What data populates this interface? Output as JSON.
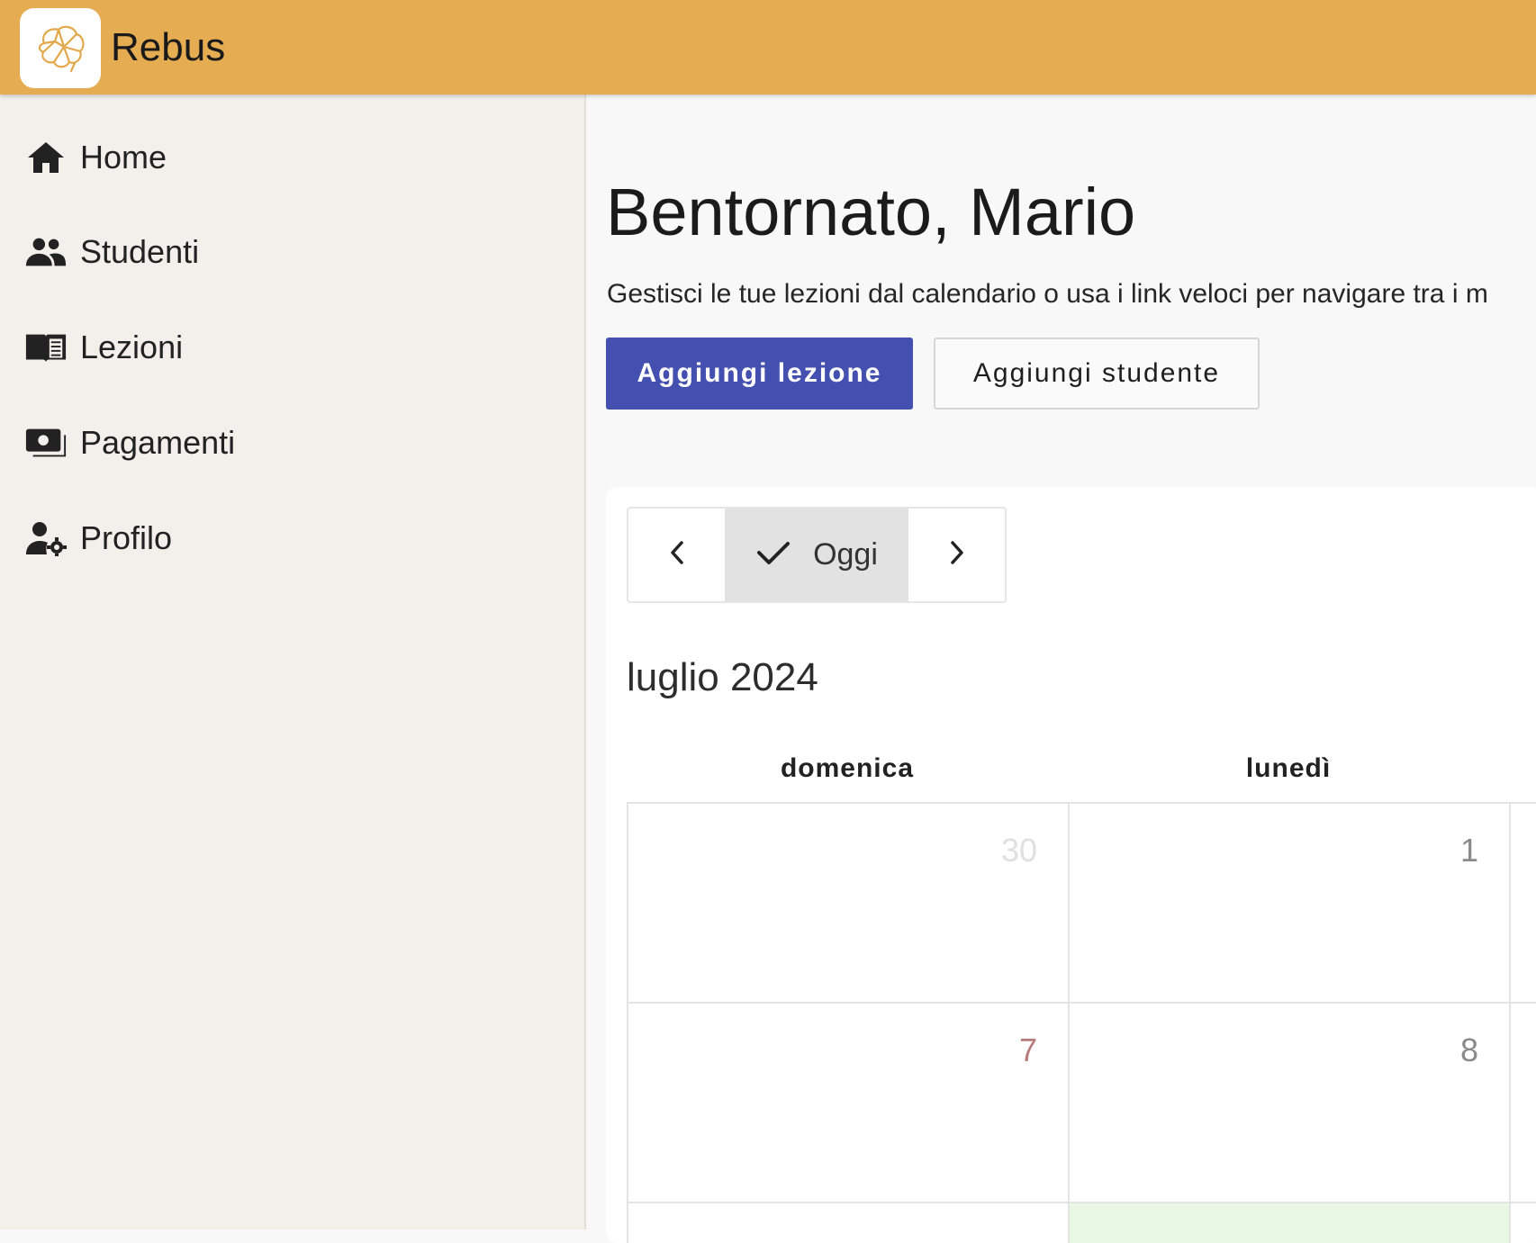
{
  "app": {
    "title": "Rebus",
    "logo_icon": "brain-icon",
    "accent": "#e5ac52"
  },
  "sidebar": {
    "items": [
      {
        "label": "Home",
        "icon": "home-icon"
      },
      {
        "label": "Studenti",
        "icon": "people-icon"
      },
      {
        "label": "Lezioni",
        "icon": "book-icon"
      },
      {
        "label": "Pagamenti",
        "icon": "payments-icon"
      },
      {
        "label": "Profilo",
        "icon": "user-settings-icon"
      }
    ]
  },
  "main": {
    "greeting": "Bentornato, Mario",
    "subtitle": "Gestisci le tue lezioni dal calendario o usa i link veloci per navigare tra i m",
    "primary_button": "Aggiungi lezione",
    "secondary_button": "Aggiungi studente",
    "primary_color": "#4350af"
  },
  "calendar": {
    "today_label": "Oggi",
    "month_label": "luglio 2024",
    "weekdays": [
      "domenica",
      "lunedì"
    ],
    "weeks": [
      [
        "30",
        "1"
      ],
      [
        "7",
        "8"
      ]
    ],
    "colors": {
      "outside_month": "#e0e0e0",
      "sunday": "#b87c7c",
      "weekday": "#8a8a8a",
      "today_bg": "#e8f6e4"
    }
  }
}
